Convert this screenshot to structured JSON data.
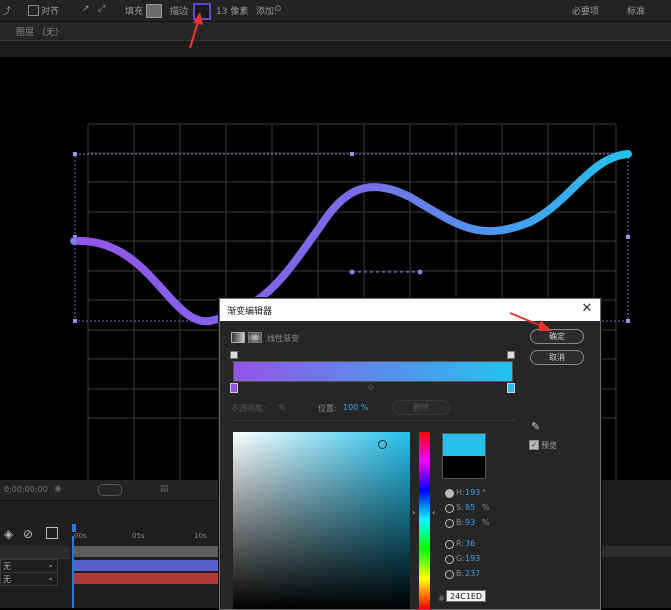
{
  "toolbar": {
    "align_label": "对齐",
    "fill_label": "填充",
    "stroke_label": "描边",
    "stroke_width": "13 像素",
    "add_label": "添加:",
    "essentials_label": "必要项",
    "standard_label": "标准",
    "layer_label": "图层 （无）"
  },
  "dialog": {
    "title": "渐变编辑器",
    "close_label": "✕",
    "gradient_type": "线性渐变",
    "ok_label": "确定",
    "cancel_label": "取消",
    "opacity_label": "不透明度:",
    "opacity_value": "%",
    "position_label": "位置:",
    "position_value": "100 %",
    "delete_label": "删除",
    "preview_label": "预览",
    "hex_prefix": "#",
    "hex_value": "24C1ED",
    "gradient_start": "#9455e8",
    "gradient_end": "#24c1ed",
    "hsb": [
      {
        "key": "H:",
        "value": "193",
        "unit": "°",
        "checked": true
      },
      {
        "key": "S:",
        "value": "85",
        "unit": "%",
        "checked": false
      },
      {
        "key": "B:",
        "value": "93",
        "unit": "%",
        "checked": false
      }
    ],
    "rgb": [
      {
        "key": "R:",
        "value": "36",
        "unit": "",
        "checked": false
      },
      {
        "key": "G:",
        "value": "193",
        "unit": "",
        "checked": false
      },
      {
        "key": "B:",
        "value": "237",
        "unit": "",
        "checked": false
      }
    ],
    "new_color": "#24c1ed",
    "old_color": "#000000"
  },
  "timeline": {
    "time": "0;00;00;00",
    "ticks": [
      "00s",
      "05s",
      "10s"
    ],
    "row1_mode": "无",
    "row2_mode": "无"
  }
}
